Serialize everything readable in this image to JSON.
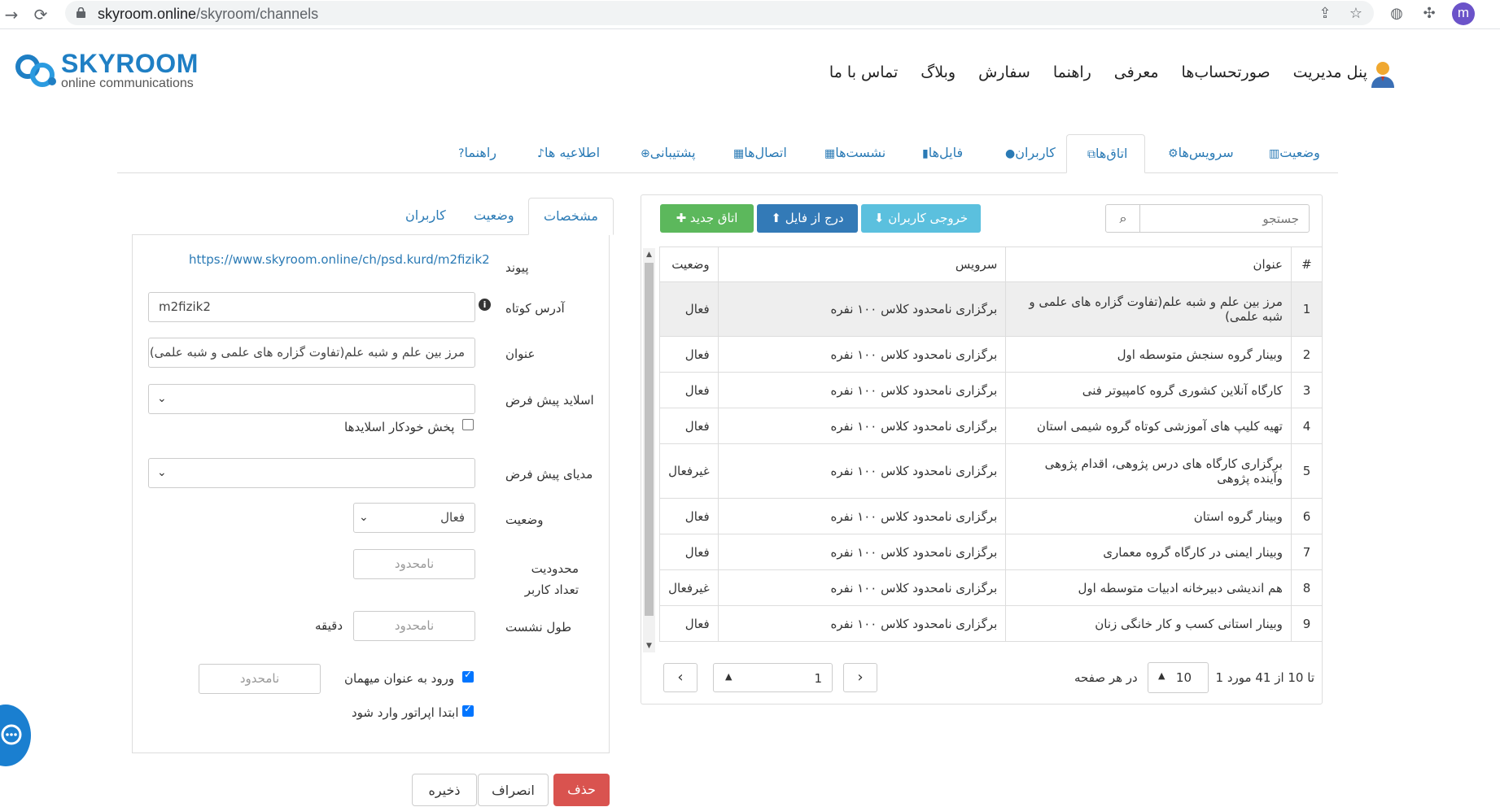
{
  "browser": {
    "url_host": "skyroom.online",
    "url_path": "/skyroom/channels",
    "profile_initial": "m"
  },
  "logo": {
    "word": "SKYROOM",
    "sub": "online communications"
  },
  "main_nav": [
    "پنل مدیریت",
    "صورتحساب‌ها",
    "معرفی",
    "راهنما",
    "سفارش",
    "وبلاگ",
    "تماس با ما"
  ],
  "tabs": [
    {
      "label": "وضعیت",
      "icon": "bar-chart-icon"
    },
    {
      "label": "سرویس‌ها",
      "icon": "gear-icon"
    },
    {
      "label": "اتاق‌ها",
      "icon": "sitemap-icon"
    },
    {
      "label": "کاربران",
      "icon": "user-icon"
    },
    {
      "label": "فایل‌ها",
      "icon": "file-icon"
    },
    {
      "label": "نشست‌ها",
      "icon": "grid-icon"
    },
    {
      "label": "اتصال‌ها",
      "icon": "grid-icon"
    },
    {
      "label": "پشتیبانی",
      "icon": "lifebuoy-icon"
    },
    {
      "label": "اطلاعیه ها",
      "icon": "bell-icon"
    },
    {
      "label": "راهنما",
      "icon": "question-icon"
    }
  ],
  "list": {
    "search_placeholder": "جستجو",
    "export_label": "خروجی کاربران",
    "import_label": "درج از فایل",
    "new_room_label": "اتاق جدید",
    "headers": {
      "num": "#",
      "title": "عنوان",
      "service": "سرویس",
      "status": "وضعیت"
    },
    "rows": [
      {
        "num": "1",
        "title": "مرز بین علم و شبه علم(تفاوت گزاره های علمی و شبه علمی)",
        "service": "برگزاری نامحدود کلاس ۱۰۰ نفره",
        "status": "فعال"
      },
      {
        "num": "2",
        "title": "وبینار گروه سنجش متوسطه اول",
        "service": "برگزاری نامحدود کلاس ۱۰۰ نفره",
        "status": "فعال"
      },
      {
        "num": "3",
        "title": "کارگاه آنلاین کشوری گروه کامپیوتر فنی",
        "service": "برگزاری نامحدود کلاس ۱۰۰ نفره",
        "status": "فعال"
      },
      {
        "num": "4",
        "title": "تهیه کلیپ های آموزشی کوتاه گروه شیمی استان",
        "service": "برگزاری نامحدود کلاس ۱۰۰ نفره",
        "status": "فعال"
      },
      {
        "num": "5",
        "title": "برگزاری کارگاه های درس پژوهی، اقدام پژوهی وآینده پژوهی",
        "service": "برگزاری نامحدود کلاس ۱۰۰ نفره",
        "status": "غیرفعال"
      },
      {
        "num": "6",
        "title": "وبینار گروه استان",
        "service": "برگزاری نامحدود کلاس ۱۰۰ نفره",
        "status": "فعال"
      },
      {
        "num": "7",
        "title": "وبینار ایمنی در کارگاه گروه معماری",
        "service": "برگزاری نامحدود کلاس ۱۰۰ نفره",
        "status": "فعال"
      },
      {
        "num": "8",
        "title": "هم اندیشی دبیرخانه ادبیات متوسطه اول",
        "service": "برگزاری نامحدود کلاس ۱۰۰ نفره",
        "status": "غیرفعال"
      },
      {
        "num": "9",
        "title": "وبینار استانی کسب و کار خانگی زنان",
        "service": "برگزاری نامحدود کلاس ۱۰۰ نفره",
        "status": "فعال"
      }
    ],
    "pager_info": "1 تا 10 از 41 مورد",
    "per_page_value": "10",
    "per_page_label": "در هر صفحه",
    "page_value": "1"
  },
  "detail": {
    "tabs": [
      "مشخصات",
      "وضعیت",
      "کاربران"
    ],
    "link_label": "پیوند",
    "link_value": "https://www.skyroom.online/ch/psd.kurd/m2fizik2",
    "short_label": "آدرس کوتاه",
    "short_value": "m2fizik2",
    "title_label": "عنوان",
    "title_value": "مرز بین علم و شبه علم(تفاوت گزاره های علمی و شبه علمی)",
    "slides_label": "اسلاید پیش فرض",
    "autoplay_label": "پخش خودکار اسلایدها",
    "media_label": "مدیای پیش فرض",
    "status_label": "وضعیت",
    "status_value": "فعال",
    "user_limit_label": "محدودیت تعداد کاربر",
    "user_limit_placeholder": "نامحدود",
    "session_len_label": "طول نشست",
    "session_len_placeholder": "نامحدود",
    "session_unit": "دقیقه",
    "guest_label": "ورود به عنوان میهمان",
    "guest_placeholder": "نامحدود",
    "operator_first_label": "ابتدا اپراتور وارد شود",
    "delete_label": "حذف",
    "cancel_label": "انصراف",
    "save_label": "ذخیره"
  },
  "colors": {
    "accent": "#2a7ab5",
    "active": "#3c8f2e",
    "inactive": "#999999",
    "danger": "#d9534f"
  }
}
